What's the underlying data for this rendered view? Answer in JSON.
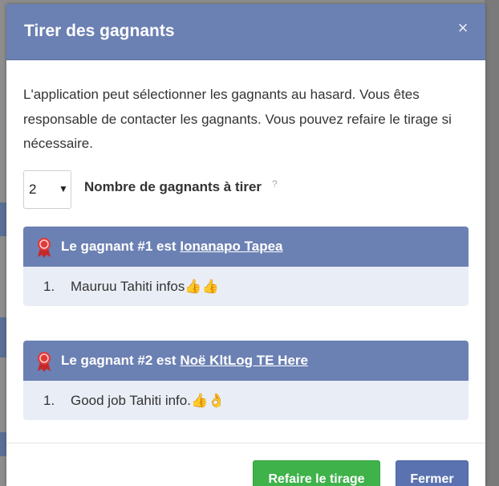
{
  "modal": {
    "title": "Tirer des gagnants",
    "close_symbol": "×",
    "intro": "L'application peut sélectionner les gagnants au hasard. Vous êtes responsable de contacter les gagnants. Vous pouvez refaire le tirage si nécessaire."
  },
  "winner_count": {
    "selected_value": "2",
    "caret": "▼",
    "label": "Nombre de gagnants à tirer",
    "help": "?"
  },
  "winners": [
    {
      "prefix": "Le gagnant #1 est",
      "name": "Ionanapo Tapea",
      "entry_number": "1.",
      "entry_text": "Mauruu Tahiti infos👍👍"
    },
    {
      "prefix": "Le gagnant #2 est",
      "name": "Noë KltLog TE Here",
      "entry_number": "1.",
      "entry_text": "Good job Tahiti info.👍👌"
    }
  ],
  "buttons": {
    "redo": "Refaire le tirage",
    "close": "Fermer"
  },
  "colors": {
    "header": "#6b80b3",
    "panel_body": "#e9edf6",
    "ribbon": "#e03a3a",
    "redo_button": "#3fb24a",
    "close_button": "#5a73b0"
  },
  "icons": {
    "winner_icon": "award-ribbon-icon",
    "close_icon": "close-icon"
  }
}
